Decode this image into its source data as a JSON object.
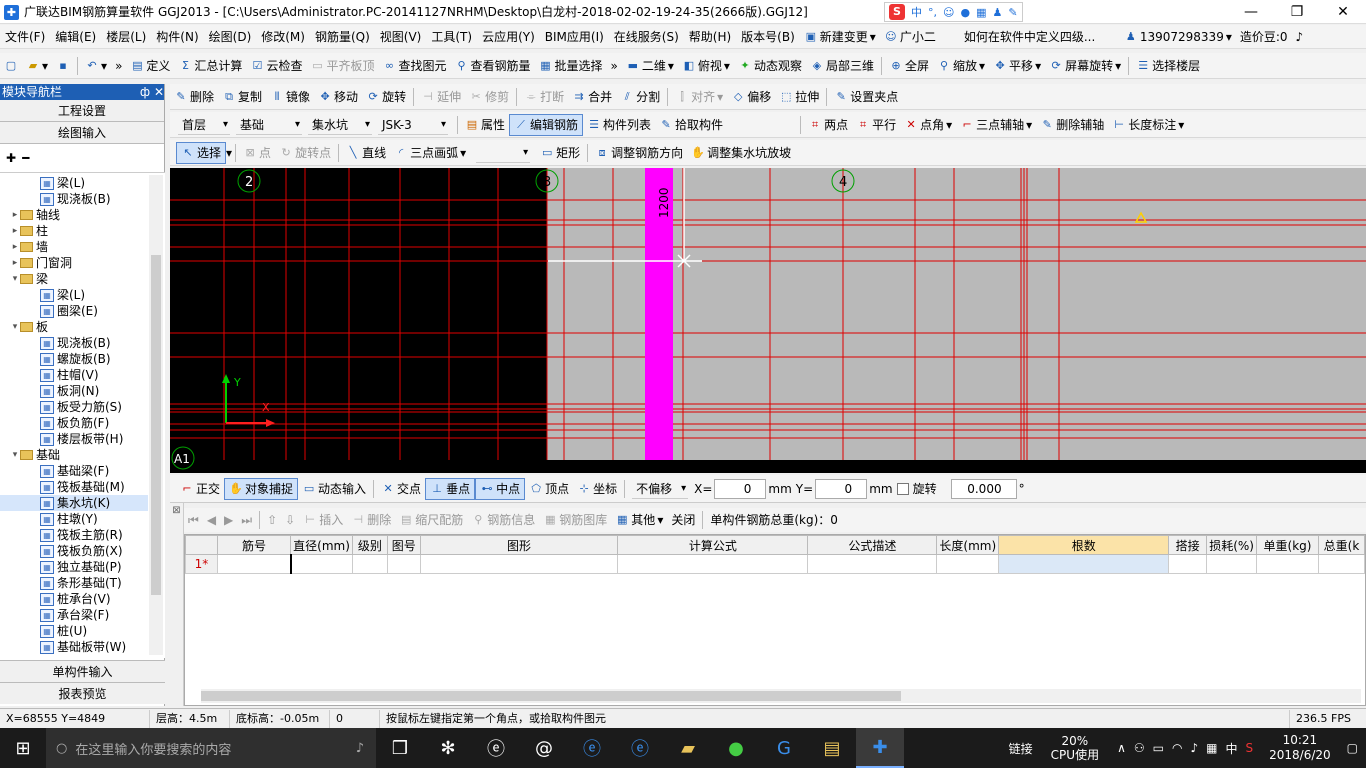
{
  "titlebar": {
    "text": "广联达BIM钢筋算量软件 GGJ2013 - [C:\\Users\\Administrator.PC-20141127NRHM\\Desktop\\白龙村-2018-02-02-19-24-35(2666版).GGJ12]",
    "ime_s": "S",
    "ime_zh": "中",
    "min": "—",
    "max": "❐",
    "close": "✕"
  },
  "menu": {
    "items": [
      "文件(F)",
      "编辑(E)",
      "楼层(L)",
      "构件(N)",
      "绘图(D)",
      "修改(M)",
      "钢筋量(Q)",
      "视图(V)",
      "工具(T)",
      "云应用(Y)",
      "BIM应用(I)",
      "在线服务(S)",
      "帮助(H)",
      "版本号(B)"
    ],
    "new_change": "新建变更",
    "assistant": "广小二",
    "question": "如何在软件中定义四级...",
    "phone": "13907298339",
    "beans": "造价豆:0"
  },
  "toolbar1": {
    "define": "定义",
    "sum": "汇总计算",
    "cloud_check": "云检查",
    "flat_top": "平齐板顶",
    "find": "查找图元",
    "view_rebar": "查看钢筋量",
    "batch": "批量选择",
    "view2d": "二维",
    "top_view": "俯视",
    "dynamic": "动态观察",
    "local3d": "局部三维",
    "fullscreen": "全屏",
    "zoom": "缩放",
    "pan": "平移",
    "rotate_screen": "屏幕旋转",
    "select_floor": "选择楼层"
  },
  "nav": {
    "header": "模块导航栏",
    "pin": "ф",
    "close": "✕",
    "project_settings": "工程设置",
    "drawing_input": "绘图输入",
    "single_input": "单构件输入",
    "report": "报表预览"
  },
  "tree": [
    {
      "label": "梁(L)",
      "level": 2,
      "type": "el"
    },
    {
      "label": "现浇板(B)",
      "level": 2,
      "type": "el"
    },
    {
      "label": "轴线",
      "level": 1,
      "type": "folder",
      "toggle": ">"
    },
    {
      "label": "柱",
      "level": 1,
      "type": "folder",
      "toggle": ">"
    },
    {
      "label": "墙",
      "level": 1,
      "type": "folder",
      "toggle": ">"
    },
    {
      "label": "门窗洞",
      "level": 1,
      "type": "folder",
      "toggle": ">"
    },
    {
      "label": "梁",
      "level": 1,
      "type": "folder",
      "toggle": "v"
    },
    {
      "label": "梁(L)",
      "level": 2,
      "type": "el"
    },
    {
      "label": "圈梁(E)",
      "level": 2,
      "type": "el"
    },
    {
      "label": "板",
      "level": 1,
      "type": "folder",
      "toggle": "v"
    },
    {
      "label": "现浇板(B)",
      "level": 2,
      "type": "el"
    },
    {
      "label": "螺旋板(B)",
      "level": 2,
      "type": "el"
    },
    {
      "label": "柱帽(V)",
      "level": 2,
      "type": "el"
    },
    {
      "label": "板洞(N)",
      "level": 2,
      "type": "el"
    },
    {
      "label": "板受力筋(S)",
      "level": 2,
      "type": "el"
    },
    {
      "label": "板负筋(F)",
      "level": 2,
      "type": "el"
    },
    {
      "label": "楼层板带(H)",
      "level": 2,
      "type": "el"
    },
    {
      "label": "基础",
      "level": 1,
      "type": "folder",
      "toggle": "v"
    },
    {
      "label": "基础梁(F)",
      "level": 2,
      "type": "el"
    },
    {
      "label": "筏板基础(M)",
      "level": 2,
      "type": "el"
    },
    {
      "label": "集水坑(K)",
      "level": 2,
      "type": "el",
      "selected": true
    },
    {
      "label": "柱墩(Y)",
      "level": 2,
      "type": "el"
    },
    {
      "label": "筏板主筋(R)",
      "level": 2,
      "type": "el"
    },
    {
      "label": "筏板负筋(X)",
      "level": 2,
      "type": "el"
    },
    {
      "label": "独立基础(P)",
      "level": 2,
      "type": "el"
    },
    {
      "label": "条形基础(T)",
      "level": 2,
      "type": "el"
    },
    {
      "label": "桩承台(V)",
      "level": 2,
      "type": "el"
    },
    {
      "label": "承台梁(F)",
      "level": 2,
      "type": "el"
    },
    {
      "label": "桩(U)",
      "level": 2,
      "type": "el"
    },
    {
      "label": "基础板带(W)",
      "level": 2,
      "type": "el"
    }
  ],
  "toolbar2": {
    "delete": "删除",
    "copy": "复制",
    "mirror": "镜像",
    "move": "移动",
    "rotate": "旋转",
    "extend": "延伸",
    "trim": "修剪",
    "break": "打断",
    "merge": "合并",
    "split": "分割",
    "align": "对齐",
    "offset": "偏移",
    "stretch": "拉伸",
    "grip": "设置夹点"
  },
  "toolbar3": {
    "floor": "首层",
    "category": "基础",
    "type": "集水坑",
    "component": "JSK-3",
    "properties": "属性",
    "edit_rebar": "编辑钢筋",
    "component_list": "构件列表",
    "pick": "拾取构件",
    "two_point": "两点",
    "parallel": "平行",
    "point_angle": "点角",
    "three_point_axis": "三点辅轴",
    "delete_axis": "删除辅轴",
    "length_mark": "长度标注"
  },
  "toolbar4": {
    "select": "选择",
    "point": "点",
    "rotate_point": "旋转点",
    "line": "直线",
    "arc": "三点画弧",
    "rect": "矩形",
    "adjust_dir": "调整钢筋方向",
    "adjust_slope": "调整集水坑放坡"
  },
  "canvas": {
    "axis_2": "2",
    "axis_3": "3",
    "axis_4": "4",
    "axis_a1": "A1",
    "dim": "1200",
    "y_label": "Y",
    "x_label": "X"
  },
  "snapbar": {
    "ortho": "正交",
    "snap": "对象捕捉",
    "dynamic_input": "动态输入",
    "intersection": "交点",
    "perpendicular": "垂点",
    "midpoint": "中点",
    "vertex": "顶点",
    "coordinate": "坐标",
    "no_offset": "不偏移",
    "x_label": "X=",
    "x_value": "0",
    "y_label": "Y=",
    "y_value": "0",
    "unit": "mm",
    "rotate": "旋转",
    "rotate_value": "0.000",
    "deg": "°"
  },
  "gridbar": {
    "insert": "插入",
    "delete": "删除",
    "scale_rebar": "缩尺配筋",
    "rebar_info": "钢筋信息",
    "rebar_lib": "钢筋图库",
    "other": "其他",
    "close": "关闭",
    "total": "单构件钢筋总重(kg)：0"
  },
  "grid": {
    "headers": [
      "筋号",
      "直径(mm)",
      "级别",
      "图号",
      "图形",
      "计算公式",
      "公式描述",
      "长度(mm)",
      "根数",
      "搭接",
      "损耗(%)",
      "单重(kg)",
      "总重(k"
    ],
    "row_label": "1*"
  },
  "status": {
    "coords": "X=68555 Y=4849",
    "floor_height": "层高：4.5m",
    "bottom_height": "底标高：-0.05m",
    "zero": "0",
    "hint": "按鼠标左键指定第一个角点，或拾取构件图元",
    "fps": "236.5 FPS"
  },
  "taskbar": {
    "search": "在这里输入你要搜索的内容",
    "link": "链接",
    "cpu_pct": "20%",
    "cpu_label": "CPU使用",
    "ime": "中",
    "time": "10:21",
    "date": "2018/6/20"
  },
  "colors": {
    "grid_red": "#e00000",
    "magenta": "#ff00ff",
    "gray_area": "#b9b9b9",
    "axis_green": "#00a000"
  }
}
